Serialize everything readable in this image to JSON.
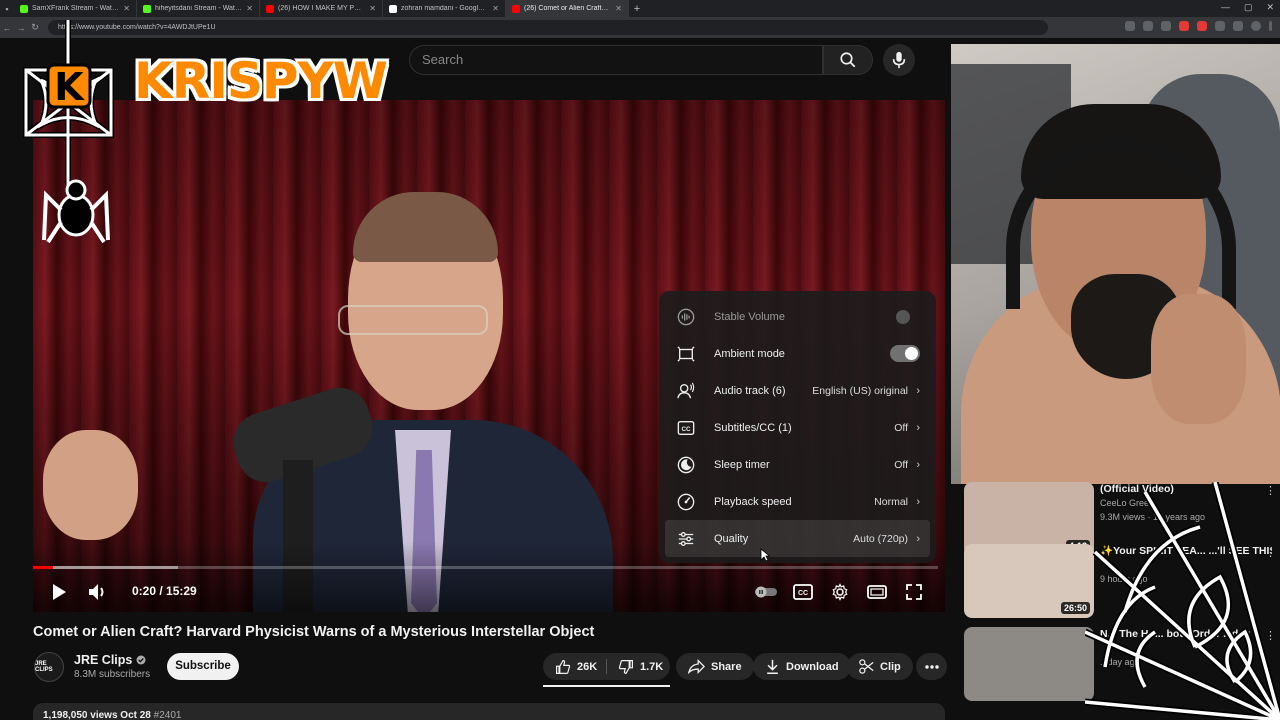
{
  "browser": {
    "tabs": [
      {
        "title": "SamXFrank Stream - Watch Live",
        "color": "#53fc18",
        "active": false
      },
      {
        "title": "hiheyitsdani Stream - Watch Live",
        "color": "#53fc18",
        "active": false
      },
      {
        "title": "(26) HOW I MAKE MY PROTEIN P...",
        "color": "#ff0000",
        "active": false
      },
      {
        "title": "zohran mamdani - Google Search",
        "color": "#ffffff",
        "active": false
      },
      {
        "title": "(26) Comet or Alien Craft? Harvar...",
        "color": "#ff0000",
        "active": true
      }
    ],
    "url": "https://www.youtube.com/watch?v=4AWDJtUPe1U"
  },
  "search": {
    "placeholder": "Search"
  },
  "overlay": {
    "logo_text": "KRISPYW",
    "logo_badge": "K"
  },
  "player": {
    "time": "0:20 / 15:29",
    "progress_played": 0.022,
    "progress_buffered": 0.16,
    "settings": [
      {
        "label": "Stable Volume",
        "value": "",
        "control": "toggle-off",
        "icon": "stable-volume-icon",
        "dim": true
      },
      {
        "label": "Ambient mode",
        "value": "",
        "control": "toggle-on",
        "icon": "ambient-mode-icon",
        "dim": false
      },
      {
        "label": "Audio track (6)",
        "value": "English (US) original",
        "control": "chevron",
        "icon": "audio-track-icon",
        "dim": false
      },
      {
        "label": "Subtitles/CC (1)",
        "value": "Off",
        "control": "chevron",
        "icon": "subtitles-icon",
        "dim": false
      },
      {
        "label": "Sleep timer",
        "value": "Off",
        "control": "chevron",
        "icon": "sleep-timer-icon",
        "dim": false
      },
      {
        "label": "Playback speed",
        "value": "Normal",
        "control": "chevron",
        "icon": "playback-speed-icon",
        "dim": false
      },
      {
        "label": "Quality",
        "value": "Auto (720p)",
        "control": "chevron",
        "icon": "quality-icon",
        "dim": false,
        "highlight": true
      }
    ]
  },
  "video": {
    "title": "Comet or Alien Craft? Harvard Physicist Warns of a Mysterious Interstellar Object",
    "channel": "JRE Clips",
    "channel_avatar": "JRE CLIPS",
    "subscribers": "8.3M subscribers",
    "subscribe_label": "Subscribe",
    "likes": "26K",
    "dislikes": "1.7K",
    "share_label": "Share",
    "download_label": "Download",
    "clip_label": "Clip",
    "views_date": "1,198,050 views  Oct 28",
    "tag": "#2401"
  },
  "recommendations": [
    {
      "title": "(Official Video)",
      "channel": "CeeLo Green",
      "meta": "9.3M views · 14 years ago",
      "duration": "4:13",
      "color": "#c9b3a6"
    },
    {
      "title": "✨Your SPIRIT TEA... ...'ll SEE THIS ... e it's ...O...",
      "channel": "",
      "meta": "9 hours ago",
      "duration": "26:50",
      "color": "#d8c7bb"
    },
    {
      "title": "N... The Ho... bot | Order ...day",
      "channel": "",
      "meta": "...day ago",
      "duration": "",
      "color": "#8d8a86"
    }
  ]
}
